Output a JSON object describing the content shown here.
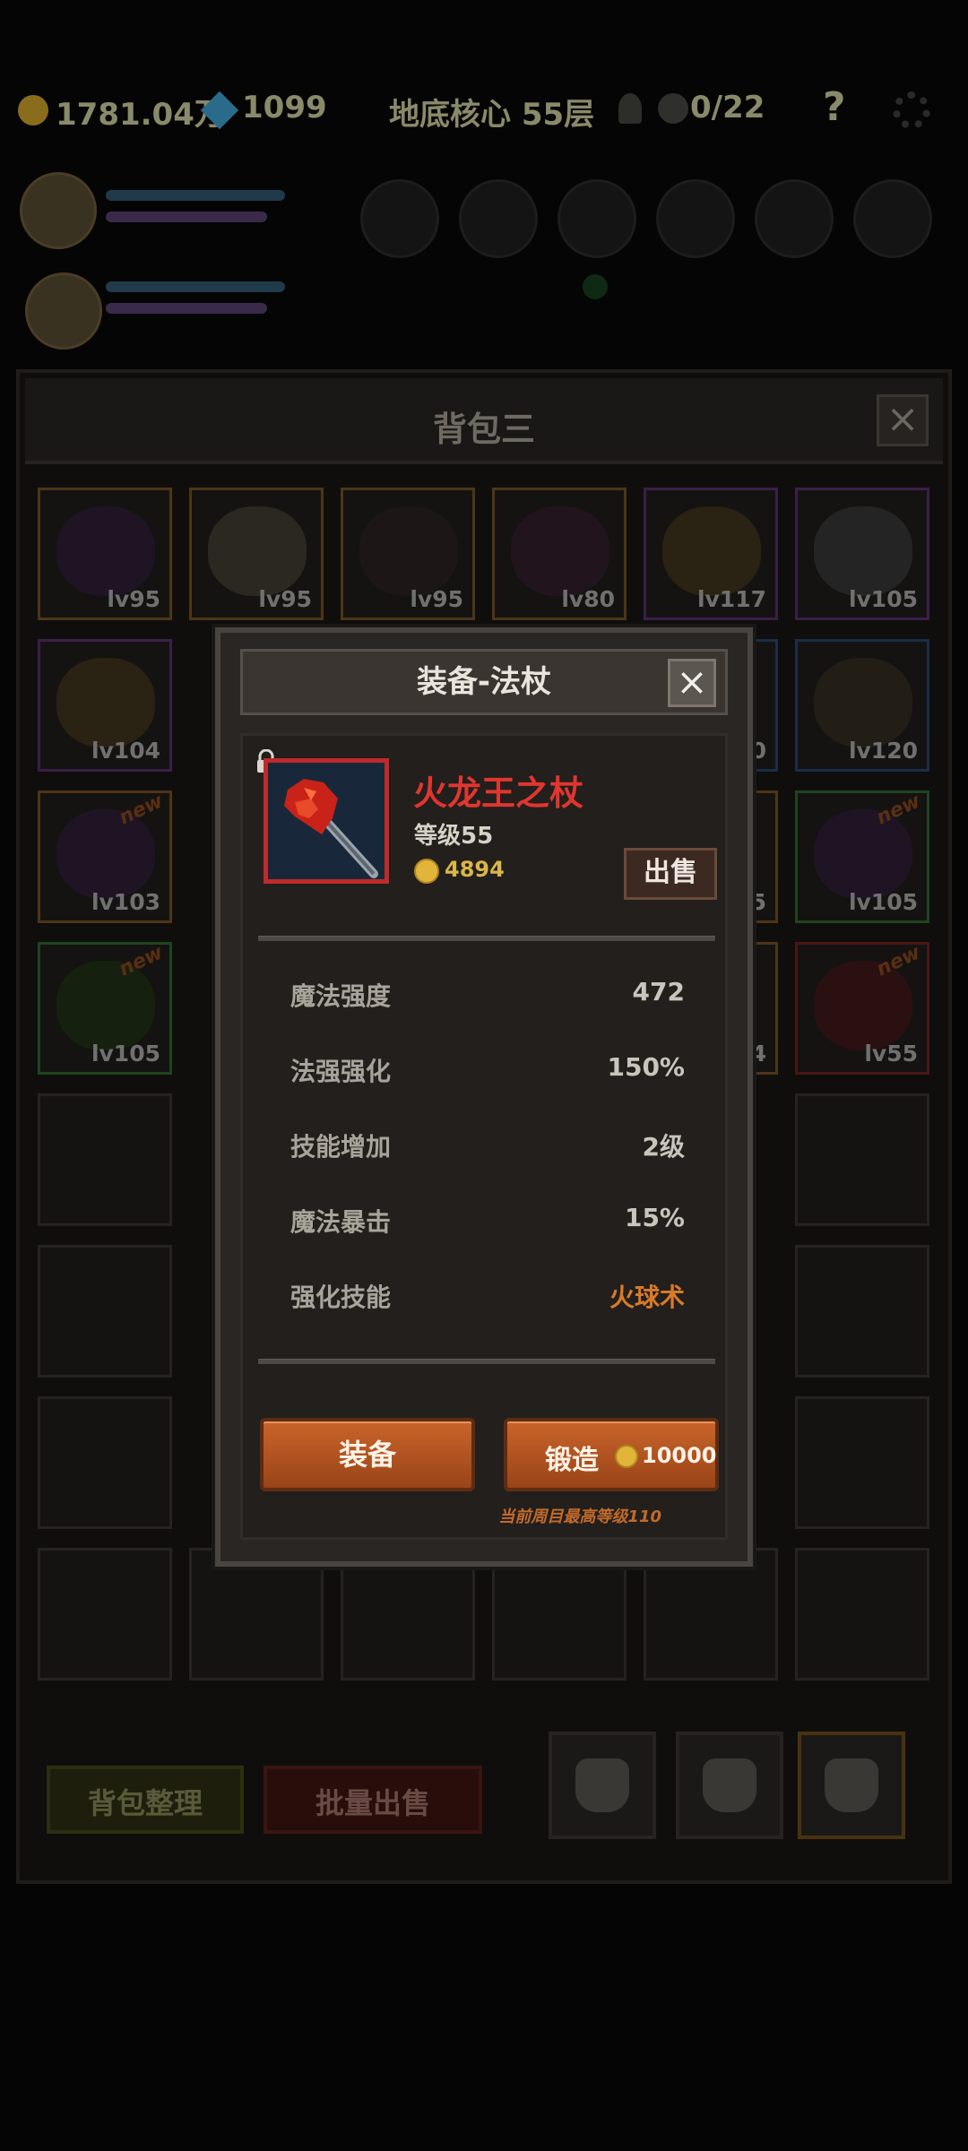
{
  "topbar": {
    "gold": "1781.04万",
    "gems": "1099",
    "location": "地底核心 55层",
    "kills": "0/22",
    "help_icon": "question-icon",
    "settings_icon": "gear-icon"
  },
  "backpack": {
    "title": "背包三",
    "sort_label": "背包整理",
    "bulk_sell_label": "批量出售",
    "items": [
      {
        "lv": "lv95",
        "rarity": "orange",
        "new": ""
      },
      {
        "lv": "lv95",
        "rarity": "orange",
        "new": ""
      },
      {
        "lv": "lv95",
        "rarity": "orange",
        "new": ""
      },
      {
        "lv": "lv80",
        "rarity": "orange",
        "new": ""
      },
      {
        "lv": "lv117",
        "rarity": "purple",
        "new": ""
      },
      {
        "lv": "lv105",
        "rarity": "purple",
        "new": ""
      },
      {
        "lv": "lv104",
        "rarity": "purple",
        "new": ""
      },
      {
        "lv": "lv120",
        "rarity": "blue",
        "new": ""
      },
      {
        "lv": "lv103",
        "rarity": "orange",
        "new": "new"
      },
      {
        "lv": "lv105",
        "rarity": "green",
        "new": "new"
      },
      {
        "lv": "lv105",
        "rarity": "green",
        "new": "new"
      },
      {
        "lv": "lv55",
        "rarity": "red",
        "new": "new"
      }
    ],
    "partial_levels": [
      "0",
      "5",
      "5",
      "4"
    ]
  },
  "modal": {
    "title": "装备-法杖",
    "item_name": "火龙王之杖",
    "item_level": "等级55",
    "price": "4894",
    "sell_label": "出售",
    "stats": [
      {
        "label": "魔法强度",
        "value": "472"
      },
      {
        "label": "法强强化",
        "value": "150%"
      },
      {
        "label": "技能增加",
        "value": "2级"
      },
      {
        "label": "魔法暴击",
        "value": "15%"
      },
      {
        "label": "强化技能",
        "value": "火球术"
      }
    ],
    "equip_label": "装备",
    "forge_label": "锻造",
    "forge_cost": "10000",
    "max_level_note": "当前周目最高等级110"
  },
  "colors": {
    "item_name": "#e0362f",
    "skill_value": "#d87a2a",
    "button_orange": "#c9642a",
    "coin": "#e2b43a"
  }
}
